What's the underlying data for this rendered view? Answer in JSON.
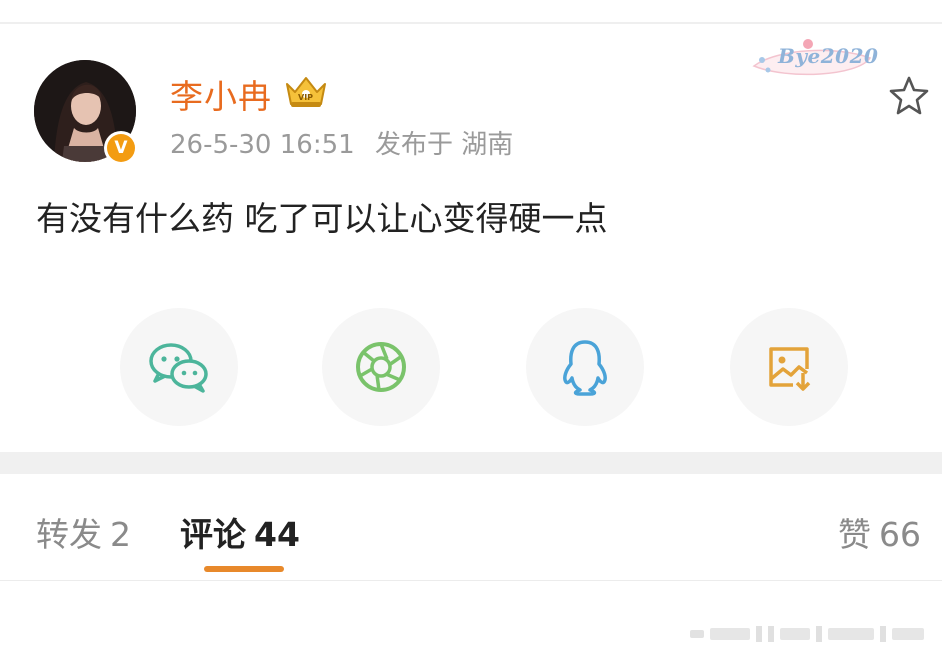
{
  "post": {
    "author": {
      "name": "李小冉",
      "verified_badge": "V",
      "vip_icon": "crown-vip-icon"
    },
    "timestamp": "26-5-30 16:51",
    "location": "发布于 湖南",
    "text": "有没有什么药 吃了可以让心变得硬一点",
    "sticker_text": "Bye2020"
  },
  "share": {
    "items": [
      {
        "icon": "wechat-icon",
        "color": "#4cb59b"
      },
      {
        "icon": "moments-icon",
        "color": "#7ac36b"
      },
      {
        "icon": "qq-icon",
        "color": "#4aa3d8"
      },
      {
        "icon": "save-image-icon",
        "color": "#e3a33a"
      }
    ]
  },
  "tabs": {
    "reposts": {
      "label": "转发",
      "count": "2"
    },
    "comments": {
      "label": "评论",
      "count": "44"
    },
    "likes": {
      "label": "赞",
      "count": "66"
    }
  },
  "colors": {
    "username": "#e86b1f",
    "accent": "#e8892b",
    "meta": "#9a9a9a",
    "verified": "#f39c12"
  }
}
